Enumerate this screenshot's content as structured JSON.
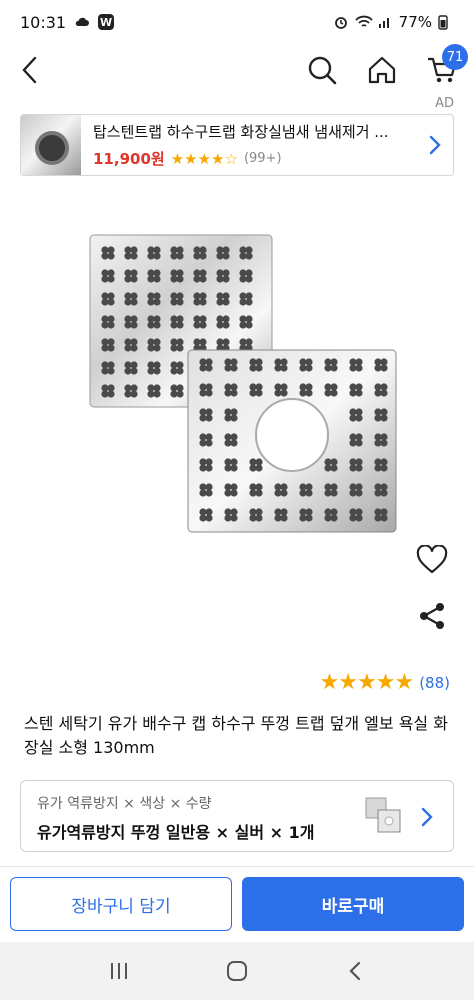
{
  "status_bar": {
    "time": "10:31",
    "battery": "77%"
  },
  "nav": {
    "cart_count": "71",
    "ad_label": "AD"
  },
  "ad": {
    "title": "탑스텐트랩 하수구트랩 화장실냄새 냄새제거 ...",
    "price": "11,900원",
    "stars": "★★★★☆",
    "review_count": "(99+)"
  },
  "product": {
    "rating_stars": "★★★★★",
    "review_count": "(88)",
    "title": "스텐 세탁기 유가 배수구 캡 하수구 뚜껑 트랩 덮개 엘보 욕실 화장실 소형 130mm"
  },
  "option": {
    "label": "유가 역류방지 × 색상 × 수량",
    "value": "유가역류방지 뚜껑 일반용 × 실버 × 1개"
  },
  "actions": {
    "add_to_cart": "장바구니 담기",
    "buy_now": "바로구매"
  },
  "icons": {
    "back": "back-icon",
    "search": "search-icon",
    "home": "home-icon",
    "cart": "cart-icon",
    "heart": "heart-icon",
    "share": "share-icon",
    "chevron": "chevron-right-icon"
  },
  "colors": {
    "accent": "#2d6fe8",
    "price": "#e0352b",
    "star": "#f5a800"
  }
}
